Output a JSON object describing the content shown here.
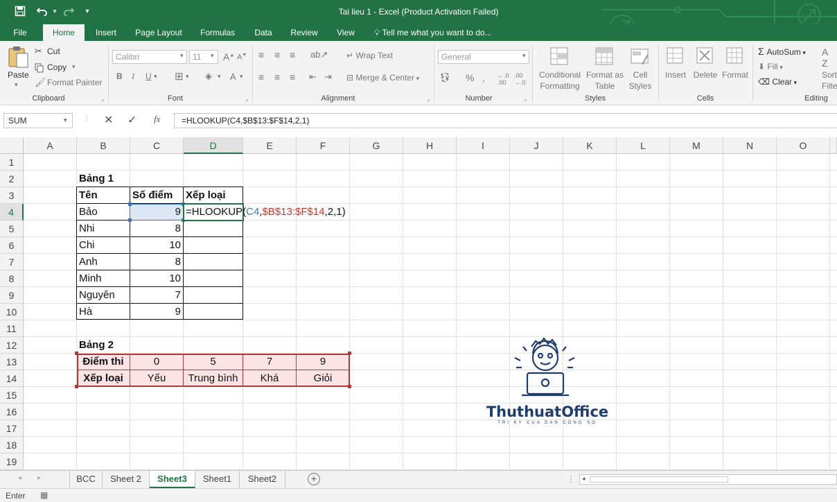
{
  "titlebar": {
    "title": "Tai lieu 1 - Excel (Product Activation Failed)"
  },
  "ribbon_tabs": [
    "File",
    "Home",
    "Insert",
    "Page Layout",
    "Formulas",
    "Data",
    "Review",
    "View"
  ],
  "tell_me": "Tell me what you want to do...",
  "clipboard": {
    "paste": "Paste",
    "cut": "Cut",
    "copy": "Copy",
    "format_painter": "Format Painter",
    "label": "Clipboard"
  },
  "font": {
    "name": "Calibri",
    "size": "11",
    "label": "Font"
  },
  "alignment": {
    "wrap_text": "Wrap Text",
    "merge_center": "Merge & Center",
    "label": "Alignment"
  },
  "number": {
    "format": "General",
    "label": "Number"
  },
  "styles": {
    "conditional_line1": "Conditional",
    "conditional_line2": "Formatting",
    "format_as_line1": "Format as",
    "format_as_line2": "Table",
    "cell_styles_line1": "Cell",
    "cell_styles_line2": "Styles",
    "label": "Styles"
  },
  "cells": {
    "insert": "Insert",
    "delete": "Delete",
    "format": "Format",
    "label": "Cells"
  },
  "editing": {
    "autosum": "AutoSum",
    "fill": "Fill",
    "clear": "Clear",
    "sort_line1": "Sort",
    "sort_line2": "Filte",
    "label": "Editing"
  },
  "formula_bar": {
    "name_box": "SUM",
    "formula": "=HLOOKUP(C4,$B$13:$F$14,2,1)"
  },
  "columns": [
    "A",
    "B",
    "C",
    "D",
    "E",
    "F",
    "G",
    "H",
    "I",
    "J",
    "K",
    "L",
    "M",
    "N",
    "O"
  ],
  "rows": [
    "1",
    "2",
    "3",
    "4",
    "5",
    "6",
    "7",
    "8",
    "9",
    "10",
    "11",
    "12",
    "13",
    "14",
    "15",
    "16",
    "17",
    "18",
    "19"
  ],
  "sheet": {
    "bang1_title": "Bảng 1",
    "bang1_headers": [
      "Tên",
      "Số điểm",
      "Xếp loại"
    ],
    "bang1_rows": [
      {
        "name": "Bảo",
        "score": "9"
      },
      {
        "name": "Nhi",
        "score": "8"
      },
      {
        "name": "Chi",
        "score": "10"
      },
      {
        "name": "Anh",
        "score": "8"
      },
      {
        "name": "Minh",
        "score": "10"
      },
      {
        "name": "Nguyên",
        "score": "7"
      },
      {
        "name": "Hà",
        "score": "9"
      }
    ],
    "edit_formula_parts": [
      "=HLOOKUP(",
      "C4",
      ",",
      "$B$13:$F$14",
      ",2,1)"
    ],
    "bang2_title": "Bảng 2",
    "bang2_row1_label": "Điểm thi",
    "bang2_row1": [
      "0",
      "5",
      "7",
      "9"
    ],
    "bang2_row2_label": "Xếp loại",
    "bang2_row2": [
      "Yếu",
      "Trung bình",
      "Khá",
      "Giỏi"
    ]
  },
  "watermark": {
    "brand": "ThuthuatOffice",
    "tagline": "TRI KY CUA DAN CONG SO"
  },
  "sheet_tabs": [
    "BCC",
    "Sheet 2",
    "Sheet3",
    "Sheet1",
    "Sheet2"
  ],
  "active_sheet": "Sheet3",
  "status": {
    "mode": "Enter"
  },
  "colors": {
    "excel_green": "#217346",
    "ref_blue": "#3a74c4",
    "ref_red": "#c0392b",
    "table2_fill": "#fce4e4"
  }
}
